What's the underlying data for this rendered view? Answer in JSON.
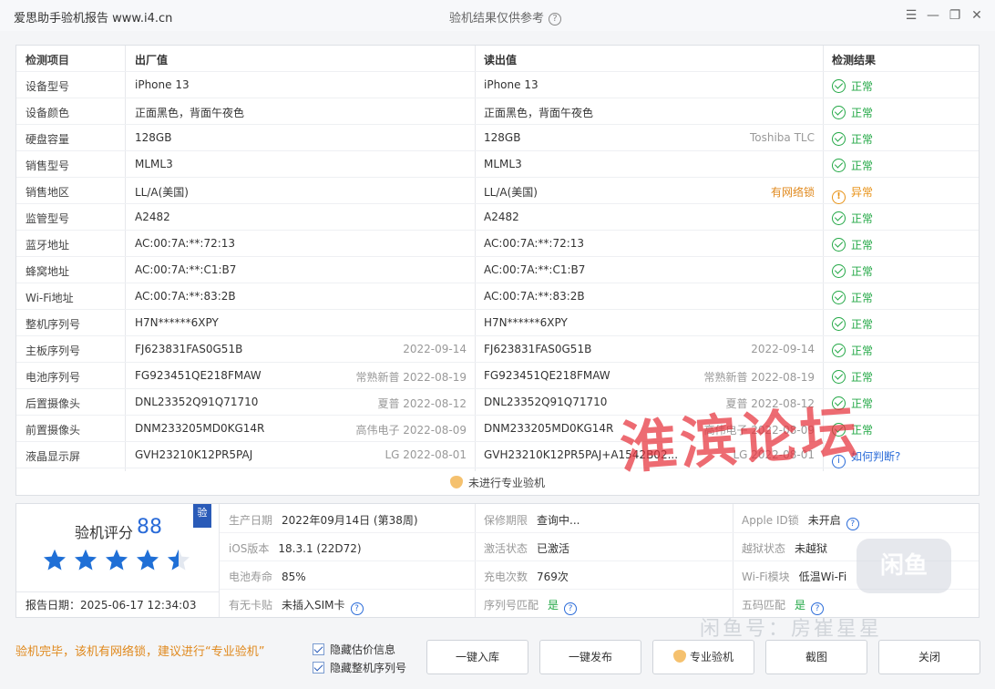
{
  "window": {
    "app_title": "爱思助手验机报告 www.i4.cn",
    "center_title": "验机结果仅供参考",
    "controls": [
      "☰",
      "—",
      "❐",
      "✕"
    ]
  },
  "table": {
    "headers": {
      "item": "检测项目",
      "factory": "出厂值",
      "read": "读出值",
      "result": "检测结果"
    },
    "rows": [
      {
        "item": "设备型号",
        "factory": "iPhone 13",
        "factory_meta": "",
        "read": "iPhone 13",
        "read_meta": "",
        "result": "正常",
        "status": "ok"
      },
      {
        "item": "设备颜色",
        "factory": "正面黑色，背面午夜色",
        "factory_meta": "",
        "read": "正面黑色，背面午夜色",
        "read_meta": "",
        "result": "正常",
        "status": "ok"
      },
      {
        "item": "硬盘容量",
        "factory": "128GB",
        "factory_meta": "",
        "read": "128GB",
        "read_meta": "Toshiba TLC",
        "result": "正常",
        "status": "ok"
      },
      {
        "item": "销售型号",
        "factory": "MLML3",
        "factory_meta": "",
        "read": "MLML3",
        "read_meta": "",
        "result": "正常",
        "status": "ok"
      },
      {
        "item": "销售地区",
        "factory": "LL/A(美国)",
        "factory_meta": "",
        "read": "LL/A(美国)",
        "read_meta": "有网络锁",
        "result": "异常",
        "status": "warn"
      },
      {
        "item": "监管型号",
        "factory": "A2482",
        "factory_meta": "",
        "read": "A2482",
        "read_meta": "",
        "result": "正常",
        "status": "ok"
      },
      {
        "item": "蓝牙地址",
        "factory": "AC:00:7A:**:72:13",
        "factory_meta": "",
        "read": "AC:00:7A:**:72:13",
        "read_meta": "",
        "result": "正常",
        "status": "ok"
      },
      {
        "item": "蜂窝地址",
        "factory": "AC:00:7A:**:C1:B7",
        "factory_meta": "",
        "read": "AC:00:7A:**:C1:B7",
        "read_meta": "",
        "result": "正常",
        "status": "ok"
      },
      {
        "item": "Wi-Fi地址",
        "factory": "AC:00:7A:**:83:2B",
        "factory_meta": "",
        "read": "AC:00:7A:**:83:2B",
        "read_meta": "",
        "result": "正常",
        "status": "ok"
      },
      {
        "item": "整机序列号",
        "factory": "H7N******6XPY",
        "factory_meta": "",
        "read": "H7N******6XPY",
        "read_meta": "",
        "result": "正常",
        "status": "ok"
      },
      {
        "item": "主板序列号",
        "factory": "FJ623831FAS0G51B",
        "factory_meta": "2022-09-14",
        "read": "FJ623831FAS0G51B",
        "read_meta": "2022-09-14",
        "result": "正常",
        "status": "ok"
      },
      {
        "item": "电池序列号",
        "factory": "FG923451QE218FMAW",
        "factory_meta": "常熟新普 2022-08-19",
        "read": "FG923451QE218FMAW",
        "read_meta": "常熟新普 2022-08-19",
        "result": "正常",
        "status": "ok"
      },
      {
        "item": "后置摄像头",
        "factory": "DNL23352Q91Q71710",
        "factory_meta": "夏普 2022-08-12",
        "read": "DNL23352Q91Q71710",
        "read_meta": "夏普 2022-08-12",
        "result": "正常",
        "status": "ok"
      },
      {
        "item": "前置摄像头",
        "factory": "DNM233205MD0KG14R",
        "factory_meta": "高伟电子 2022-08-09",
        "read": "DNM233205MD0KG14R",
        "read_meta": "高伟电子 2022-08-09",
        "result": "正常",
        "status": "ok"
      },
      {
        "item": "液晶显示屏",
        "factory": "GVH23210K12PR5PAJ",
        "factory_meta": "LG 2022-08-01",
        "read": "GVH23210K12PR5PAJ+A1542B02...",
        "read_meta": "LG 2022-08-01",
        "result": "如何判断?",
        "status": "info"
      }
    ],
    "notice": "未进行专业验机"
  },
  "score": {
    "label": "验机评分",
    "value": "88",
    "badge": "验",
    "stars": 4.5,
    "report_date": "报告日期：2025-06-17 12:34:03"
  },
  "info": {
    "col1": [
      {
        "label": "生产日期",
        "value": "2022年09月14日 (第38周)"
      },
      {
        "label": "iOS版本",
        "value": "18.3.1 (22D72)"
      },
      {
        "label": "电池寿命",
        "value": "85%"
      },
      {
        "label": "有无卡贴",
        "value": "未插入SIM卡"
      }
    ],
    "col2": [
      {
        "label": "保修期限",
        "value": "查询中..."
      },
      {
        "label": "激活状态",
        "value": "已激活"
      },
      {
        "label": "充电次数",
        "value": "769次"
      },
      {
        "label": "序列号匹配",
        "value": "是"
      }
    ],
    "col3": [
      {
        "label": "Apple ID锁",
        "value": "未开启"
      },
      {
        "label": "越狱状态",
        "value": "未越狱"
      },
      {
        "label": "Wi-Fi模块",
        "value": "低温Wi-Fi"
      },
      {
        "label": "五码匹配",
        "value": "是"
      }
    ]
  },
  "footer": {
    "message": "验机完毕，该机有网络锁，建议进行“专业验机”",
    "checkbox1": "隐藏估价信息",
    "checkbox2": "隐藏整机序列号",
    "buttons": [
      "一键入库",
      "一键发布",
      "专业验机",
      "截图",
      "关闭"
    ]
  },
  "watermarks": {
    "forum": "淮滨论坛",
    "logo": "闲鱼",
    "account": "闲鱼号：房崔星星"
  },
  "colors": {
    "ok": "#23a846",
    "warn": "#e89216",
    "accent": "#2a6bd8",
    "footer_message": "#e0891d"
  }
}
